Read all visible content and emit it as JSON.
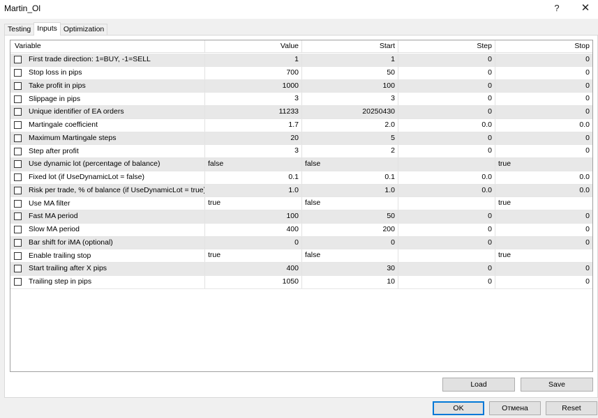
{
  "window": {
    "title": "Martin_Ol",
    "help_label": "?",
    "close_label": "✕"
  },
  "tabs": [
    {
      "label": "Testing",
      "active": false
    },
    {
      "label": "Inputs",
      "active": true
    },
    {
      "label": "Optimization",
      "active": false
    }
  ],
  "table": {
    "columns": [
      "Variable",
      "Value",
      "Start",
      "Step",
      "Stop"
    ],
    "rows": [
      {
        "variable": "First trade direction: 1=BUY, -1=SELL",
        "value": "1",
        "start": "1",
        "step": "0",
        "stop": "0",
        "checked": false
      },
      {
        "variable": "Stop loss in pips",
        "value": "700",
        "start": "50",
        "step": "0",
        "stop": "0",
        "checked": false
      },
      {
        "variable": "Take profit in pips",
        "value": "1000",
        "start": "100",
        "step": "0",
        "stop": "0",
        "checked": false
      },
      {
        "variable": "Slippage in pips",
        "value": "3",
        "start": "3",
        "step": "0",
        "stop": "0",
        "checked": false
      },
      {
        "variable": "Unique identifier of EA orders",
        "value": "11233",
        "start": "20250430",
        "step": "0",
        "stop": "0",
        "checked": false
      },
      {
        "variable": "Martingale coefficient",
        "value": "1.7",
        "start": "2.0",
        "step": "0.0",
        "stop": "0.0",
        "checked": false
      },
      {
        "variable": "Maximum Martingale steps",
        "value": "20",
        "start": "5",
        "step": "0",
        "stop": "0",
        "checked": false
      },
      {
        "variable": "Step after profit",
        "value": "3",
        "start": "2",
        "step": "0",
        "stop": "0",
        "checked": false
      },
      {
        "variable": "Use dynamic lot (percentage of balance)",
        "value": "false",
        "start": "false",
        "step": "",
        "stop": "true",
        "checked": false,
        "bool": true
      },
      {
        "variable": "Fixed lot (if UseDynamicLot = false)",
        "value": "0.1",
        "start": "0.1",
        "step": "0.0",
        "stop": "0.0",
        "checked": false
      },
      {
        "variable": "Risk per trade, % of balance (if UseDynamicLot = true)",
        "value": "1.0",
        "start": "1.0",
        "step": "0.0",
        "stop": "0.0",
        "checked": false
      },
      {
        "variable": "Use MA filter",
        "value": "true",
        "start": "false",
        "step": "",
        "stop": "true",
        "checked": false,
        "bool": true
      },
      {
        "variable": "Fast MA period",
        "value": "100",
        "start": "50",
        "step": "0",
        "stop": "0",
        "checked": false
      },
      {
        "variable": "Slow MA period",
        "value": "400",
        "start": "200",
        "step": "0",
        "stop": "0",
        "checked": false
      },
      {
        "variable": "Bar shift for iMA (optional)",
        "value": "0",
        "start": "0",
        "step": "0",
        "stop": "0",
        "checked": false
      },
      {
        "variable": "Enable trailing stop",
        "value": "true",
        "start": "false",
        "step": "",
        "stop": "true",
        "checked": false,
        "bool": true
      },
      {
        "variable": "Start trailing after X pips",
        "value": "400",
        "start": "30",
        "step": "0",
        "stop": "0",
        "checked": false
      },
      {
        "variable": "Trailing step in pips",
        "value": "1050",
        "start": "10",
        "step": "0",
        "stop": "0",
        "checked": false
      }
    ]
  },
  "buttons": {
    "load": "Load",
    "save": "Save",
    "ok": "OK",
    "cancel": "Отмена",
    "reset": "Reset"
  }
}
